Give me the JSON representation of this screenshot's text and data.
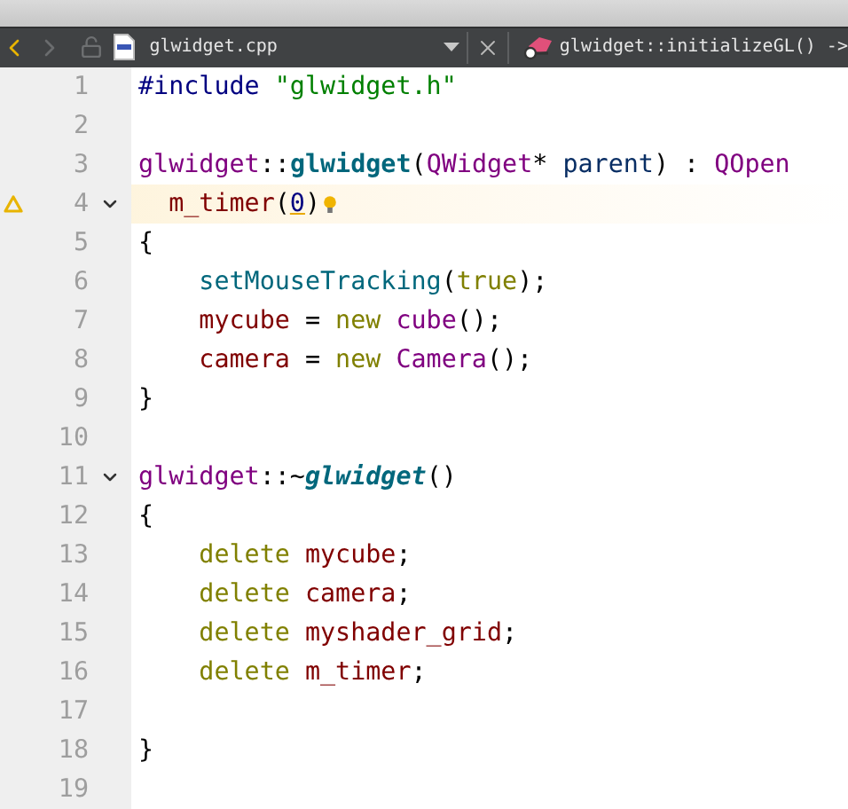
{
  "toolbar": {
    "nav": [
      {
        "kind": "back",
        "disabled": false
      },
      {
        "kind": "forward",
        "disabled": true
      }
    ],
    "file": {
      "name": "glwidget.cpp"
    },
    "symbol": {
      "name": "glwidget::initializeGL() ->"
    }
  },
  "lines": [
    {
      "number": "1",
      "current": false,
      "warning": false,
      "foldable": false,
      "hint": false,
      "tokens": [
        {
          "kind": "preproc",
          "text": "#include "
        },
        {
          "kind": "string",
          "text": "\"glwidget.h\""
        }
      ]
    },
    {
      "number": "2",
      "current": false,
      "warning": false,
      "foldable": false,
      "hint": false
    },
    {
      "number": "3",
      "current": false,
      "warning": false,
      "foldable": false,
      "hint": false,
      "tokens": [
        {
          "kind": "type",
          "text": "glwidget"
        },
        {
          "kind": "plain",
          "text": "::"
        },
        {
          "kind": "decl",
          "text": "glwidget"
        },
        {
          "kind": "plain",
          "text": "("
        },
        {
          "kind": "type",
          "text": "QWidget"
        },
        {
          "kind": "plain",
          "text": "* "
        },
        {
          "kind": "param",
          "text": "parent"
        },
        {
          "kind": "plain",
          "text": ") : "
        },
        {
          "kind": "type",
          "text": "QOpen"
        }
      ]
    },
    {
      "number": "4",
      "current": true,
      "warning": true,
      "foldable": true,
      "hint": true,
      "tokens": [
        {
          "kind": "member",
          "text": "  m_timer"
        },
        {
          "kind": "plain",
          "text": "("
        },
        {
          "kind": "warned-number",
          "text": "0"
        },
        {
          "kind": "plain",
          "text": ")"
        }
      ]
    },
    {
      "number": "5",
      "current": false,
      "warning": false,
      "foldable": false,
      "hint": false,
      "tokens": [
        {
          "kind": "plain",
          "text": "{"
        }
      ]
    },
    {
      "number": "6",
      "current": false,
      "warning": false,
      "foldable": false,
      "hint": false,
      "tokens": [
        {
          "kind": "function",
          "text": "    setMouseTracking"
        },
        {
          "kind": "plain",
          "text": "("
        },
        {
          "kind": "keyword",
          "text": "true"
        },
        {
          "kind": "plain",
          "text": ");"
        }
      ]
    },
    {
      "number": "7",
      "current": false,
      "warning": false,
      "foldable": false,
      "hint": false,
      "tokens": [
        {
          "kind": "member",
          "text": "    mycube"
        },
        {
          "kind": "plain",
          "text": " = "
        },
        {
          "kind": "keyword",
          "text": "new "
        },
        {
          "kind": "type",
          "text": "cube"
        },
        {
          "kind": "plain",
          "text": "();"
        }
      ]
    },
    {
      "number": "8",
      "current": false,
      "warning": false,
      "foldable": false,
      "hint": false,
      "tokens": [
        {
          "kind": "member",
          "text": "    camera"
        },
        {
          "kind": "plain",
          "text": " = "
        },
        {
          "kind": "keyword",
          "text": "new "
        },
        {
          "kind": "type",
          "text": "Camera"
        },
        {
          "kind": "plain",
          "text": "();"
        }
      ]
    },
    {
      "number": "9",
      "current": false,
      "warning": false,
      "foldable": false,
      "hint": false,
      "tokens": [
        {
          "kind": "plain",
          "text": "}"
        }
      ]
    },
    {
      "number": "10",
      "current": false,
      "warning": false,
      "foldable": false,
      "hint": false
    },
    {
      "number": "11",
      "current": false,
      "warning": false,
      "foldable": true,
      "hint": false,
      "tokens": [
        {
          "kind": "type",
          "text": "glwidget"
        },
        {
          "kind": "plain",
          "text": "::~"
        },
        {
          "kind": "decl-virtual",
          "text": "glwidget"
        },
        {
          "kind": "plain",
          "text": "()"
        }
      ]
    },
    {
      "number": "12",
      "current": false,
      "warning": false,
      "foldable": false,
      "hint": false,
      "tokens": [
        {
          "kind": "plain",
          "text": "{"
        }
      ]
    },
    {
      "number": "13",
      "current": false,
      "warning": false,
      "foldable": false,
      "hint": false,
      "tokens": [
        {
          "kind": "keyword",
          "text": "    delete "
        },
        {
          "kind": "member",
          "text": "mycube"
        },
        {
          "kind": "plain",
          "text": ";"
        }
      ]
    },
    {
      "number": "14",
      "current": false,
      "warning": false,
      "foldable": false,
      "hint": false,
      "tokens": [
        {
          "kind": "keyword",
          "text": "    delete "
        },
        {
          "kind": "member",
          "text": "camera"
        },
        {
          "kind": "plain",
          "text": ";"
        }
      ]
    },
    {
      "number": "15",
      "current": false,
      "warning": false,
      "foldable": false,
      "hint": false,
      "tokens": [
        {
          "kind": "keyword",
          "text": "    delete "
        },
        {
          "kind": "member",
          "text": "myshader_grid"
        },
        {
          "kind": "plain",
          "text": ";"
        }
      ]
    },
    {
      "number": "16",
      "current": false,
      "warning": false,
      "foldable": false,
      "hint": false,
      "tokens": [
        {
          "kind": "keyword",
          "text": "    delete "
        },
        {
          "kind": "member",
          "text": "m_timer"
        },
        {
          "kind": "plain",
          "text": ";"
        }
      ]
    },
    {
      "number": "17",
      "current": false,
      "warning": false,
      "foldable": false,
      "hint": false
    },
    {
      "number": "18",
      "current": false,
      "warning": false,
      "foldable": false,
      "hint": false,
      "tokens": [
        {
          "kind": "plain",
          "text": "}"
        }
      ]
    },
    {
      "number": "19",
      "current": false,
      "warning": false,
      "foldable": false,
      "hint": false
    }
  ]
}
